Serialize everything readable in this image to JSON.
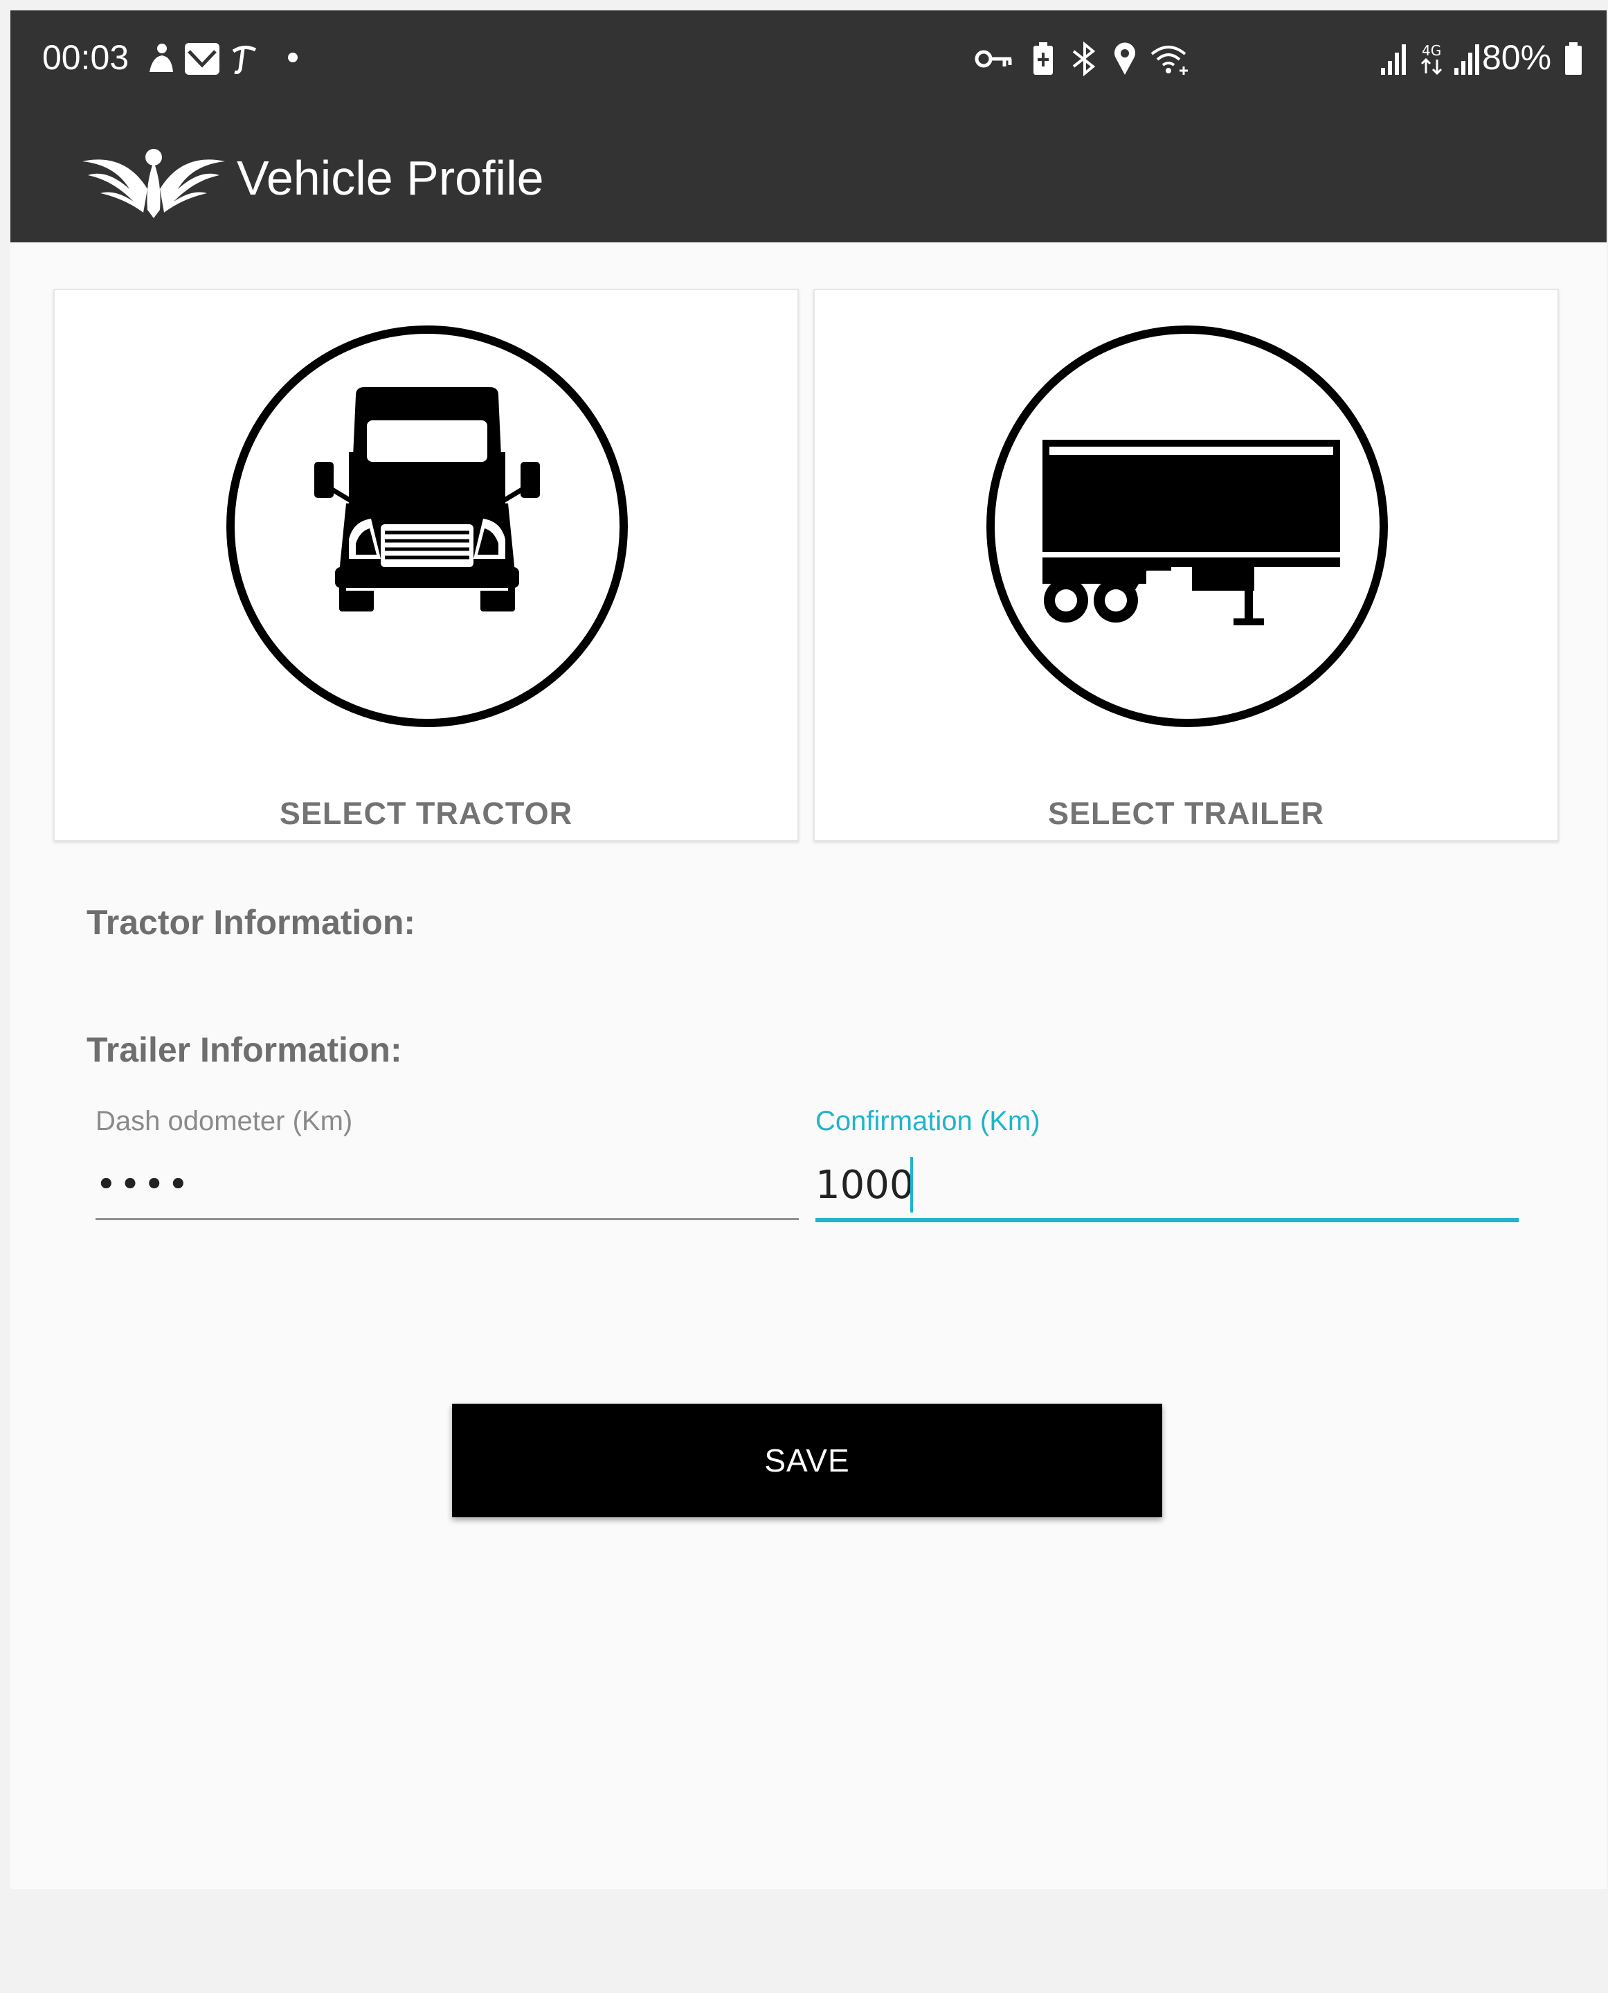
{
  "status_bar": {
    "time": "00:03",
    "battery": "80%",
    "left_icons": [
      "notification-app-icon",
      "mail-app-icon",
      "tiktok-icon",
      "dot-icon"
    ],
    "right_icons": [
      "vpn-key-icon",
      "battery-saver-icon",
      "bluetooth-icon",
      "location-icon",
      "wifi-icon",
      "signal-icon",
      "network-4g-icon",
      "signal-icon",
      "battery-icon"
    ]
  },
  "app_bar": {
    "title": "Vehicle Profile",
    "logo_icon": "eagle-logo-icon"
  },
  "cards": {
    "tractor": {
      "label": "SELECT TRACTOR",
      "icon": "truck-icon"
    },
    "trailer": {
      "label": "SELECT TRAILER",
      "icon": "trailer-icon"
    }
  },
  "sections": {
    "tractor_heading": "Tractor Information:",
    "trailer_heading": "Trailer Information:"
  },
  "form": {
    "odometer": {
      "label": "Dash odometer (Km)",
      "value": "••••"
    },
    "confirmation": {
      "label": "Confirmation (Km)",
      "value": "1000"
    }
  },
  "save_label": "SAVE",
  "colors": {
    "app_bar": "#333333",
    "background": "#fafafa",
    "accent": "#1eb4cc",
    "label_gray": "#6e6e6e",
    "button": "#000000"
  }
}
